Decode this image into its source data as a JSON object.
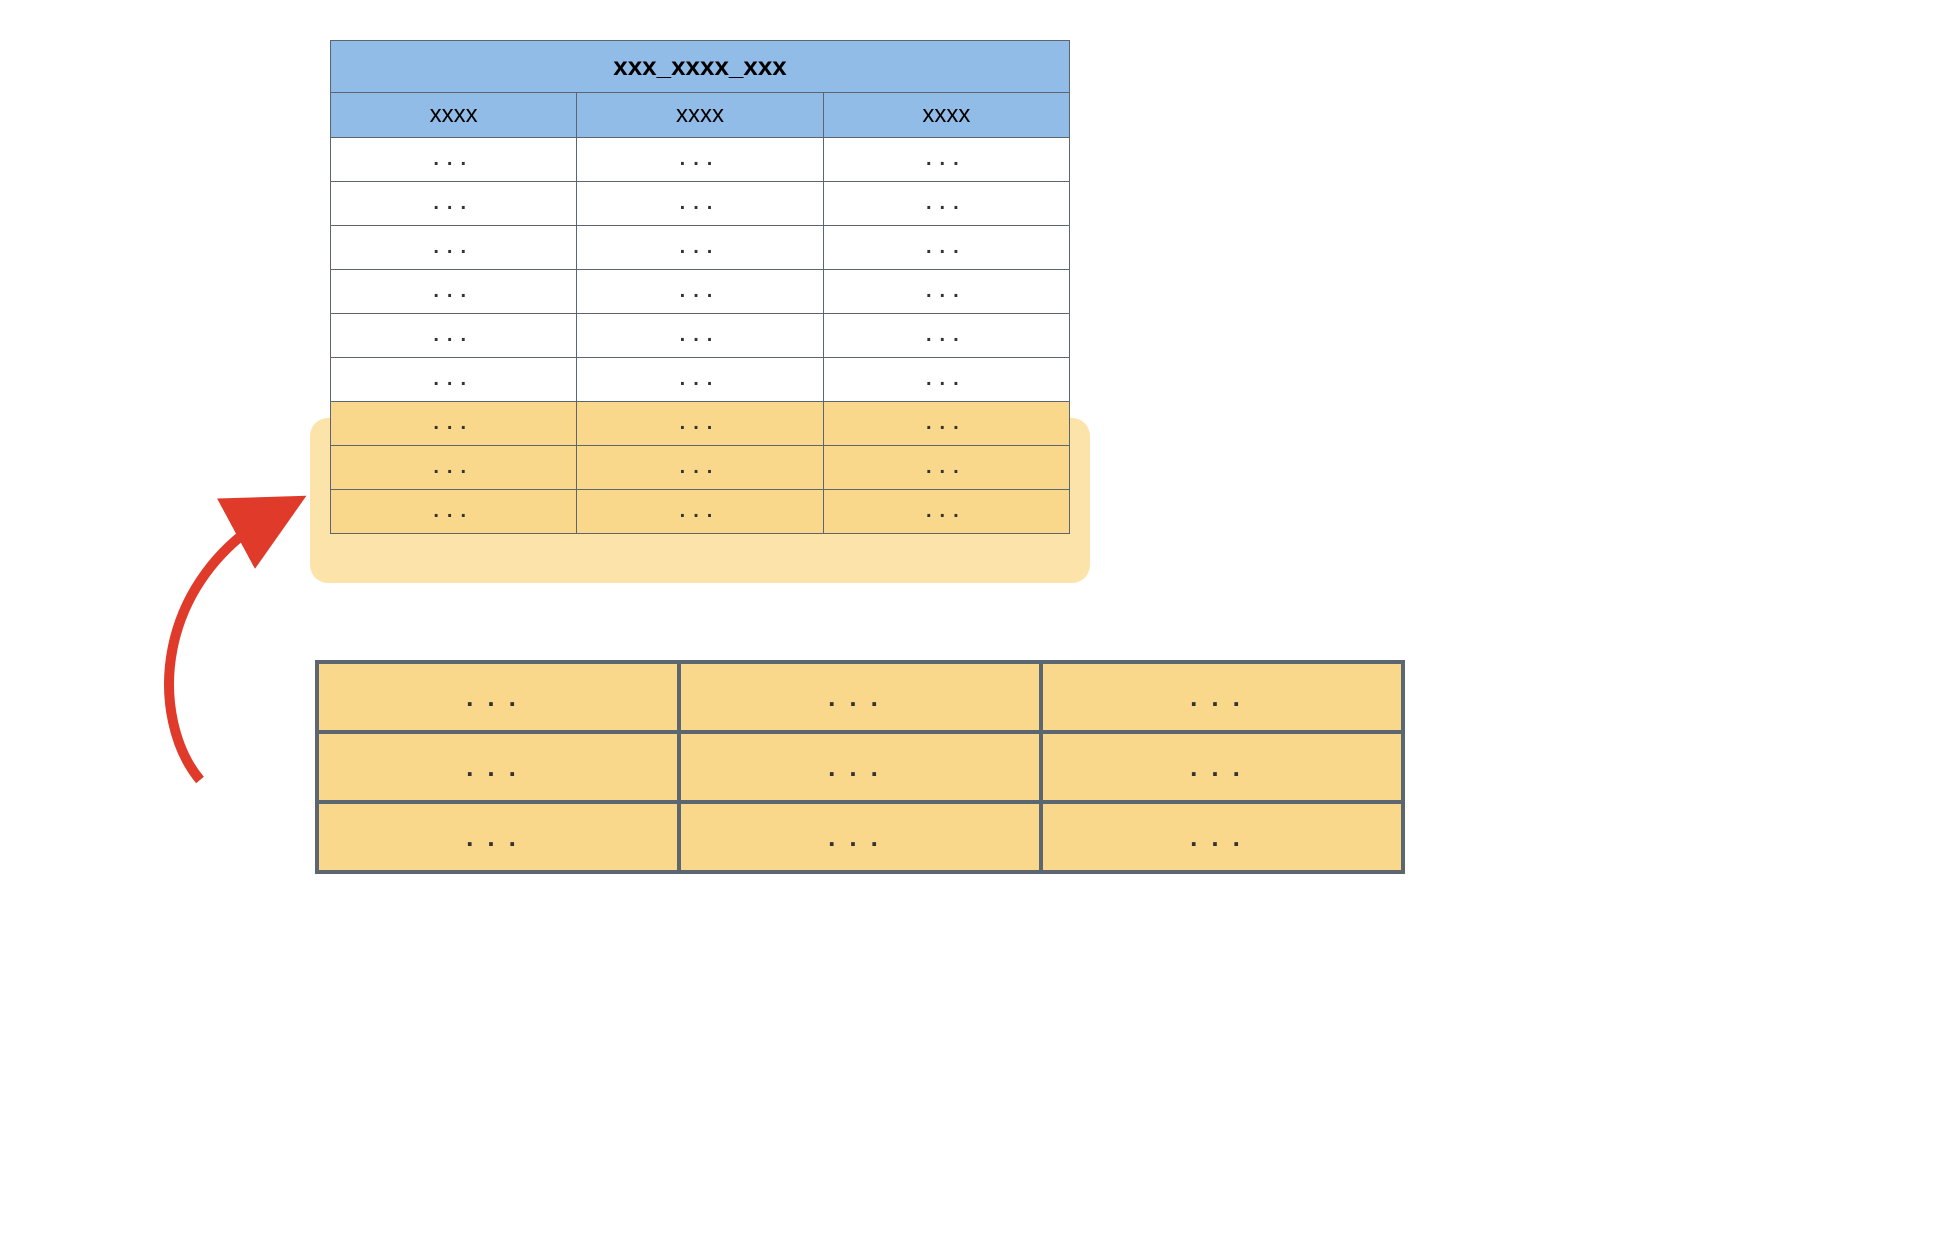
{
  "top_table": {
    "title": "xxx_xxxx_xxx",
    "headers": [
      "xxxx",
      "xxxx",
      "xxxx"
    ],
    "rows": [
      {
        "cells": [
          "...",
          "...",
          "..."
        ],
        "highlighted": false
      },
      {
        "cells": [
          "...",
          "...",
          "..."
        ],
        "highlighted": false
      },
      {
        "cells": [
          "...",
          "...",
          "..."
        ],
        "highlighted": false
      },
      {
        "cells": [
          "...",
          "...",
          "..."
        ],
        "highlighted": false
      },
      {
        "cells": [
          "...",
          "...",
          "..."
        ],
        "highlighted": false
      },
      {
        "cells": [
          "...",
          "...",
          "..."
        ],
        "highlighted": false
      },
      {
        "cells": [
          "...",
          "...",
          "..."
        ],
        "highlighted": true
      },
      {
        "cells": [
          "...",
          "...",
          "..."
        ],
        "highlighted": true
      },
      {
        "cells": [
          "...",
          "...",
          "..."
        ],
        "highlighted": true
      }
    ]
  },
  "bottom_table": {
    "rows": [
      {
        "cells": [
          "...",
          "...",
          "..."
        ]
      },
      {
        "cells": [
          "...",
          "...",
          "..."
        ]
      },
      {
        "cells": [
          "...",
          "...",
          "..."
        ]
      }
    ]
  },
  "colors": {
    "header_bg": "#92bce8",
    "highlight_bg": "#f9d88b",
    "highlight_overlay": "#fbe3a9",
    "border": "#5c6670",
    "arrow": "#e03a2a"
  }
}
